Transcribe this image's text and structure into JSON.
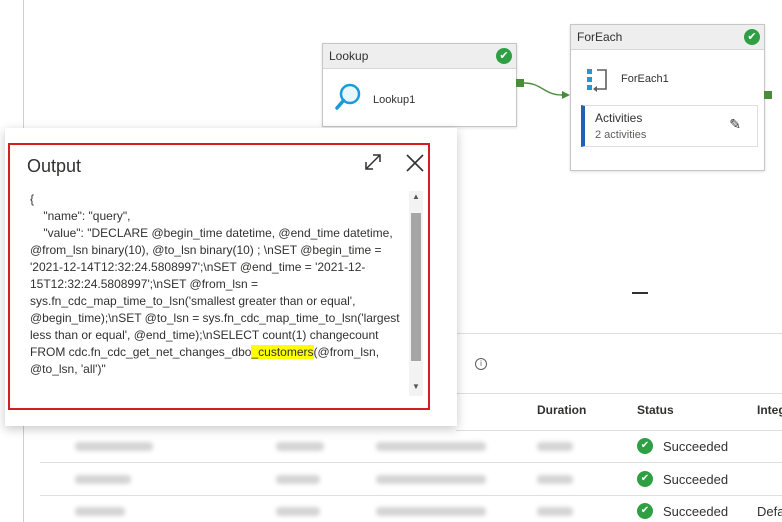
{
  "pipeline": {
    "lookup": {
      "header": "Lookup",
      "name": "Lookup1"
    },
    "foreach": {
      "header": "ForEach",
      "name": "ForEach1",
      "activities_title": "Activities",
      "activities_count": "2 activities"
    }
  },
  "output_panel": {
    "title": "Output",
    "json_open": "{",
    "json_line1": "    \"name\": \"query\",",
    "json_line2": "    \"value\": \"DECLARE @begin_time datetime, @end_time datetime, @from_lsn binary(10), @to_lsn binary(10) ; \\nSET @begin_time = '2021-12-14T12:32:24.5808997';\\nSET @end_time = '2021-12-15T12:32:24.5808997';\\nSET @from_lsn = sys.fn_cdc_map_time_to_lsn('smallest greater than or equal', @begin_time);\\nSET @to_lsn = sys.fn_cdc_map_time_to_lsn('largest less than or equal', @end_time);\\nSELECT count(1) changecount FROM cdc.fn_cdc_get_net_changes_dbo",
    "json_highlight": "_customers",
    "json_tail": "(@from_lsn, @to_lsn, 'all')\""
  },
  "runs_table": {
    "columns": [
      "Duration",
      "Status",
      "Integ"
    ],
    "rows": [
      {
        "status": "Succeeded",
        "integration": ""
      },
      {
        "status": "Succeeded",
        "integration": ""
      },
      {
        "status": "Succeeded",
        "integration": "Defa"
      }
    ]
  },
  "icons": {
    "check": "✔",
    "info": "i",
    "pencil": "✎",
    "scroll_up": "▲",
    "scroll_down": "▼"
  },
  "colors": {
    "success_green": "#2ea043",
    "connector_green": "#4a8c3c",
    "highlight_frame": "#d21f1f",
    "activities_accent": "#1f64b3",
    "text_highlight": "#ffff00"
  }
}
